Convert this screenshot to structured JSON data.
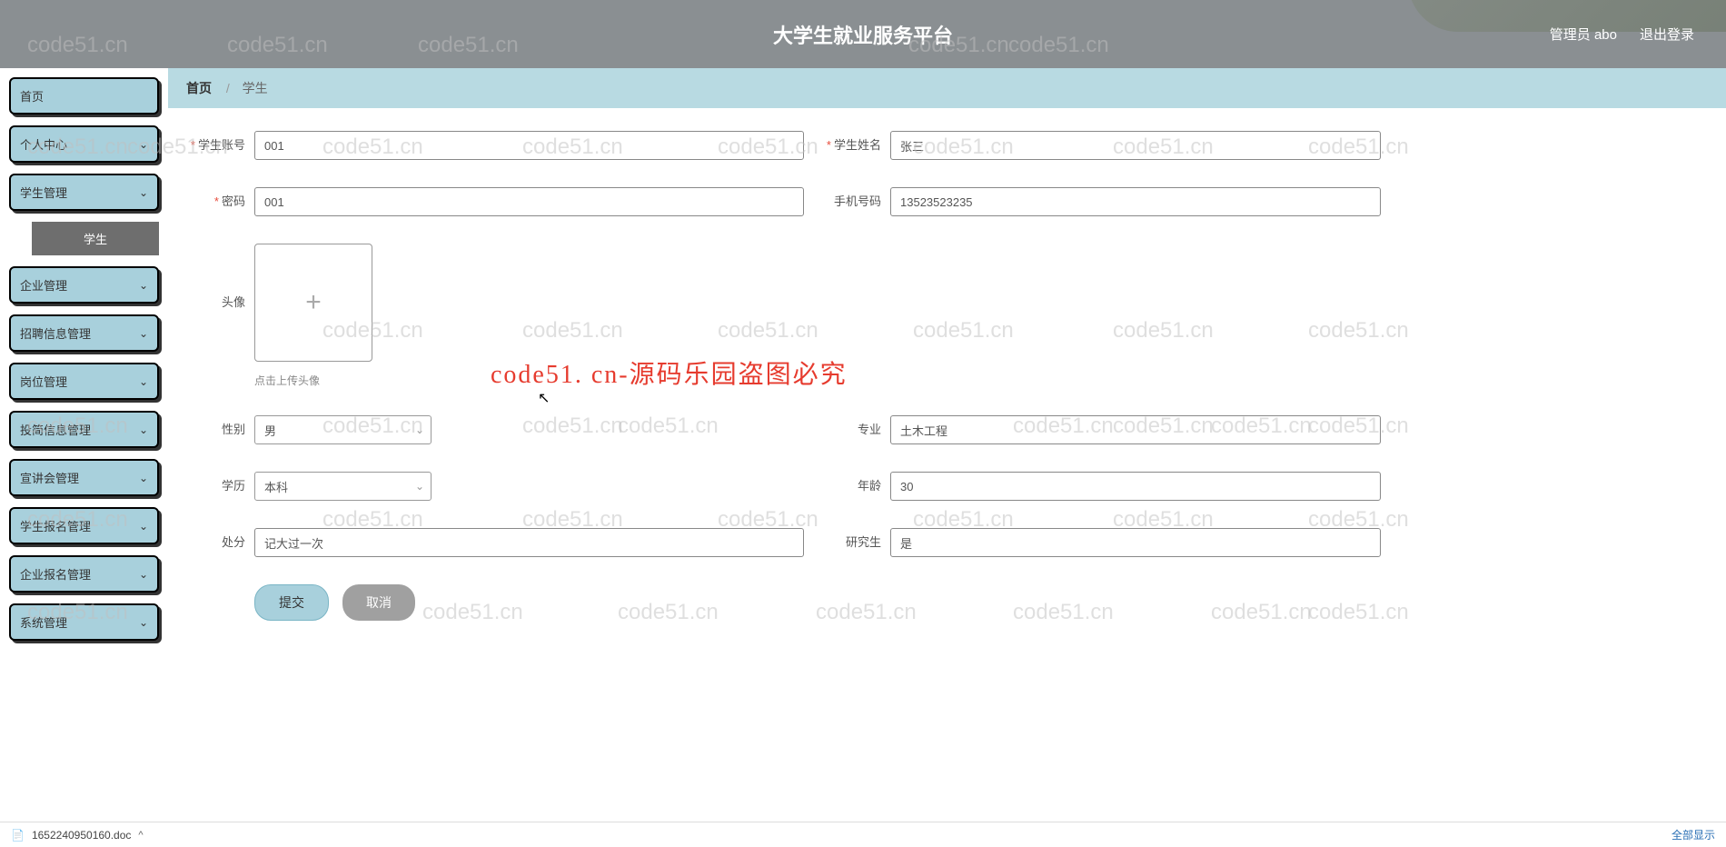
{
  "header": {
    "title": "大学生就业服务平台",
    "user_label": "管理员 abo",
    "logout": "退出登录"
  },
  "sidebar": {
    "items": [
      {
        "label": "首页",
        "expandable": false
      },
      {
        "label": "个人中心",
        "expandable": true
      },
      {
        "label": "学生管理",
        "expandable": true,
        "children": [
          {
            "label": "学生"
          }
        ]
      },
      {
        "label": "企业管理",
        "expandable": true
      },
      {
        "label": "招聘信息管理",
        "expandable": true
      },
      {
        "label": "岗位管理",
        "expandable": true
      },
      {
        "label": "投简信息管理",
        "expandable": true
      },
      {
        "label": "宣讲会管理",
        "expandable": true
      },
      {
        "label": "学生报名管理",
        "expandable": true
      },
      {
        "label": "企业报名管理",
        "expandable": true
      },
      {
        "label": "系统管理",
        "expandable": true
      }
    ]
  },
  "breadcrumb": {
    "home": "首页",
    "current": "学生"
  },
  "form": {
    "account": {
      "label": "学生账号",
      "value": "001",
      "required": true
    },
    "name": {
      "label": "学生姓名",
      "value": "张三",
      "required": true
    },
    "password": {
      "label": "密码",
      "value": "001",
      "required": true
    },
    "phone": {
      "label": "手机号码",
      "value": "13523523235",
      "required": false
    },
    "avatar": {
      "label": "头像",
      "hint": "点击上传头像"
    },
    "gender": {
      "label": "性别",
      "value": "男"
    },
    "major": {
      "label": "专业",
      "value": "土木工程"
    },
    "education": {
      "label": "学历",
      "value": "本科"
    },
    "age": {
      "label": "年龄",
      "value": "30"
    },
    "punishment": {
      "label": "处分",
      "value": "记大过一次"
    },
    "postgrad": {
      "label": "研究生",
      "value": "是"
    }
  },
  "buttons": {
    "submit": "提交",
    "cancel": "取消"
  },
  "watermarks": {
    "wm": "code51.cn",
    "center": "code51. cn-源码乐园盗图必究"
  },
  "download": {
    "filename": "1652240950160.doc",
    "showall": "全部显示"
  }
}
